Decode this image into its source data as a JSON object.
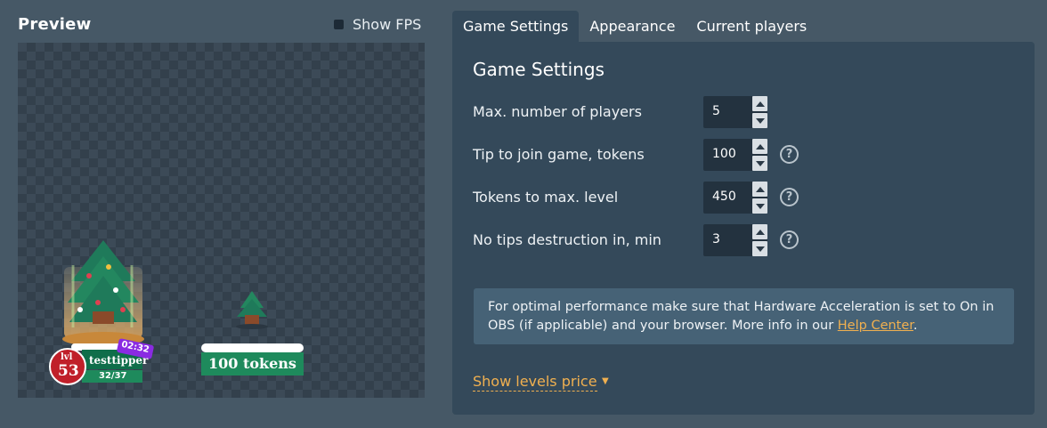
{
  "preview": {
    "title": "Preview",
    "show_fps_label": "Show FPS",
    "show_fps_checked": false,
    "game": {
      "player": {
        "lvl_label": "lvl",
        "level": "53",
        "name": "testtipper",
        "progress": "32/37",
        "timer": "02:32"
      },
      "slot_tokens": "100 tokens"
    }
  },
  "tabs": [
    {
      "label": "Game Settings",
      "active": true
    },
    {
      "label": "Appearance",
      "active": false
    },
    {
      "label": "Current players",
      "active": false
    }
  ],
  "settings": {
    "title": "Game Settings",
    "fields": [
      {
        "label": "Max. number of players",
        "value": "5",
        "help": false
      },
      {
        "label": "Tip to join game, tokens",
        "value": "100",
        "help": true
      },
      {
        "label": "Tokens to max. level",
        "value": "450",
        "help": true
      },
      {
        "label": "No tips destruction in, min",
        "value": "3",
        "help": true
      }
    ],
    "help_icon_text": "?",
    "info": {
      "text": "For optimal performance make sure that Hardware Acceleration is set to On in OBS (if applicable) and your browser. More info in our ",
      "link": "Help Center",
      "end": "."
    },
    "levels_link": "Show levels price",
    "levels_arrow": "▼"
  },
  "colors": {
    "background": "#465866",
    "panel": "#34495a",
    "accent": "#f0b050",
    "token_green": "#1e8a5c",
    "level_red": "#c0202a",
    "timer_purple": "#8a2be2"
  }
}
